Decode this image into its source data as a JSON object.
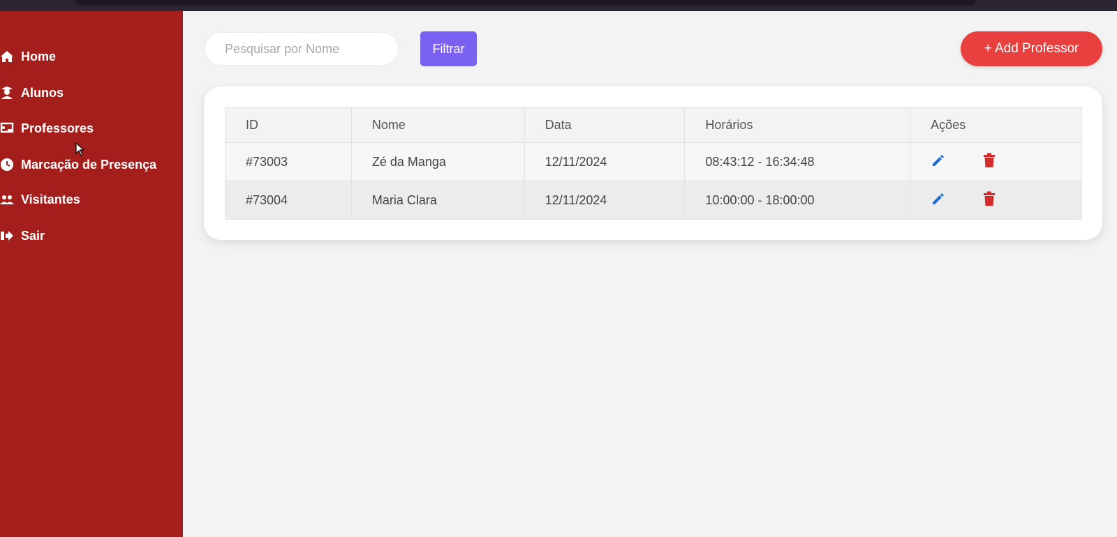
{
  "sidebar": {
    "items": [
      {
        "label": "Home",
        "icon": "home-icon"
      },
      {
        "label": "Alunos",
        "icon": "student-icon"
      },
      {
        "label": "Professores",
        "icon": "teacher-icon"
      },
      {
        "label": "Marcação de Presença",
        "icon": "clock-icon"
      },
      {
        "label": "Visitantes",
        "icon": "users-icon"
      },
      {
        "label": "Sair",
        "icon": "sign-out-icon"
      }
    ]
  },
  "toolbar": {
    "search_placeholder": "Pesquisar por Nome",
    "filter_label": "Filtrar",
    "add_label": "+ Add Professor"
  },
  "table": {
    "columns": [
      "ID",
      "Nome",
      "Data",
      "Horários",
      "Ações"
    ],
    "rows": [
      {
        "id": "#73003",
        "nome": "Zé da Manga",
        "data": "12/11/2024",
        "horarios": "08:43:12 - 16:34:48"
      },
      {
        "id": "#73004",
        "nome": "Maria Clara",
        "data": "12/11/2024",
        "horarios": "10:00:00 - 18:00:00"
      }
    ]
  },
  "colors": {
    "sidebar": "#a41f1b",
    "filter_button": "#7a61f2",
    "add_button": "#e83f3f",
    "edit_icon": "#1e6fd0",
    "delete_icon": "#d42a2a",
    "background": "#f3f3f3"
  }
}
